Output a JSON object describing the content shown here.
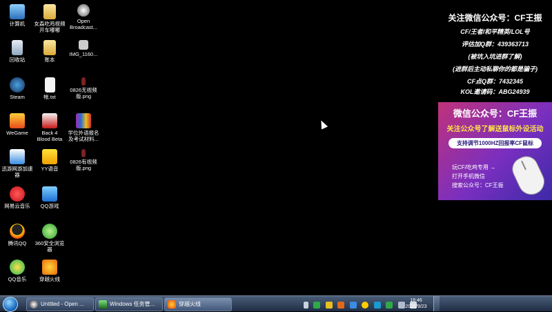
{
  "desktop": {
    "icons": [
      {
        "label": "计算机"
      },
      {
        "label": "女森吃鸡视频\n开车嘟嘟"
      },
      {
        "label": "Open\nBroadcast..."
      },
      {
        "label": "回收站"
      },
      {
        "label": "账本"
      },
      {
        "label": "IMG_1160..."
      },
      {
        "label": "Steam"
      },
      {
        "label": "帐.txt"
      },
      {
        "label": "0826无视频\n版.png"
      },
      {
        "label": "WeGame"
      },
      {
        "label": "Back 4\nBlood Beta"
      },
      {
        "label": "学位外语报名\n及考试材料..."
      },
      {
        "label": "迅游网游加速\n器"
      },
      {
        "label": "YY语音"
      },
      {
        "label": "0826有视频\n版.png"
      },
      {
        "label": "网易云音乐"
      },
      {
        "label": "QQ游戏"
      },
      {
        "label": "腾讯QQ"
      },
      {
        "label": "360安全浏览\n器"
      },
      {
        "label": "QQ音乐"
      },
      {
        "label": "穿越火线"
      }
    ]
  },
  "promo": {
    "head": "关注微信公众号：CF王振",
    "line1": "CF/王者/和平精英/LOL号",
    "line2": "评估加Q群：439363713",
    "line3": "(被坑入坑进群了解)",
    "line4": "(进群后主动私聊你的都是骗子)",
    "line5": "CF点Q群：7432345",
    "line6": "KOL邀请码：ABG24939",
    "banner": {
      "title": "微信公众号：CF王振",
      "subtitle": "关注公众号了解送鼠标外设活动",
      "pill": "支持调节1000HZ回报率CF鼠标",
      "list": [
        "玩CF/吃鸡专用 →",
        "打开手机微信",
        "搜索公众号：CF王振"
      ]
    }
  },
  "taskbar": {
    "tasks": [
      {
        "label": "Untitled - Open ..."
      },
      {
        "label": "Windows 任务管..."
      },
      {
        "label": "穿越火线"
      }
    ],
    "clock_time": "18:46",
    "clock_date": "2021/9/23"
  }
}
